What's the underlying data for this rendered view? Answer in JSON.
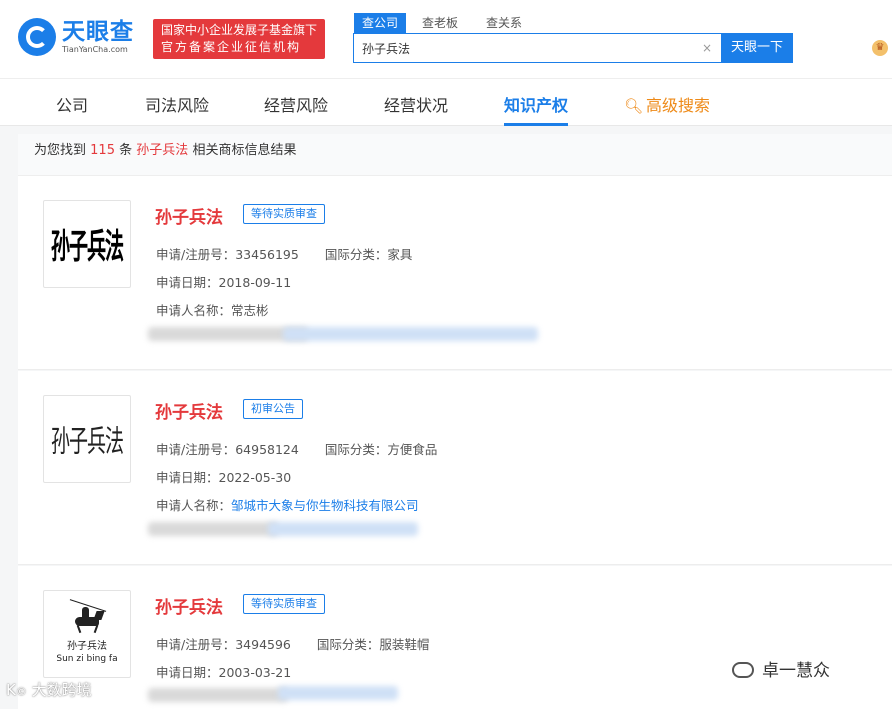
{
  "header": {
    "logo_cn": "天眼查",
    "logo_en": "TianYanCha.com",
    "badge_line1": "国家中小企业发展子基金旗下",
    "badge_line2": "官方备案企业征信机构",
    "search_tabs": [
      "查公司",
      "查老板",
      "查关系"
    ],
    "search_value": "孙子兵法",
    "clear_icon": "×",
    "search_button": "天眼一下",
    "user_icon": "crown-icon"
  },
  "nav": {
    "items": [
      "公司",
      "司法风险",
      "经营风险",
      "经营状况",
      "知识产权"
    ],
    "active": "知识产权",
    "advanced_search": "高级搜索",
    "advanced_icon": "search-icon"
  },
  "result": {
    "prefix": "为您找到",
    "count": "115",
    "unit": "条",
    "keyword": "孙子兵法",
    "suffix": "相关商标信息结果"
  },
  "cards": [
    {
      "thumb_text": "孙子兵法",
      "title": "孙子兵法",
      "status": "等待实质审查",
      "reg_label": "申请/注册号：",
      "reg_no": "33456195",
      "class_label": "国际分类：",
      "class_value": "家具",
      "date_label": "申请日期：",
      "date": "2018-09-11",
      "applicant_label": "申请人名称：",
      "applicant": "常志彬"
    },
    {
      "thumb_text": "孙子兵法",
      "title": "孙子兵法",
      "status": "初审公告",
      "reg_label": "申请/注册号：",
      "reg_no": "64958124",
      "class_label": "国际分类：",
      "class_value": "方便食品",
      "date_label": "申请日期：",
      "date": "2022-05-30",
      "applicant_label": "申请人名称：",
      "applicant": "邹城市大象与你生物科技有限公司"
    },
    {
      "thumb_cn": "孙子兵法",
      "thumb_en": "Sun zi bing fa",
      "title": "孙子兵法",
      "status": "等待实质审查",
      "reg_label": "申请/注册号：",
      "reg_no": "3494596",
      "class_label": "国际分类：",
      "class_value": "服装鞋帽",
      "date_label": "申请日期：",
      "date": "2003-03-21"
    }
  ],
  "watermarks": {
    "left": "大数跨境",
    "right": "卓一慧众"
  },
  "colors": {
    "brand_blue": "#1b7ee8",
    "highlight_red": "#e4393c",
    "advanced_orange": "#ee8a18"
  }
}
